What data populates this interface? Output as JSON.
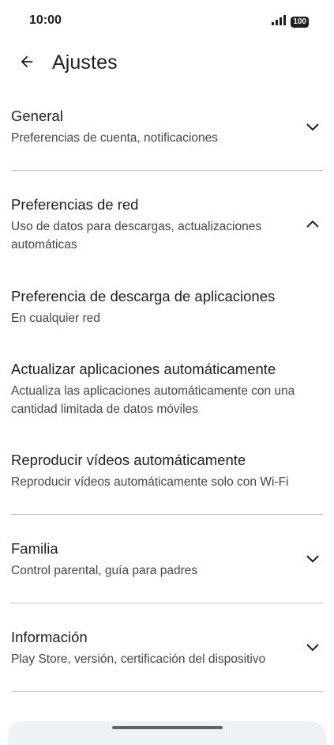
{
  "status_bar": {
    "time": "10:00",
    "battery": "100"
  },
  "header": {
    "title": "Ajustes"
  },
  "settings": [
    {
      "title": "General",
      "subtitle": "Preferencias de cuenta, notificaciones",
      "expanded": false
    },
    {
      "title": "Preferencias de red",
      "subtitle": "Uso de datos para descargas, actualizaciones automáticas",
      "expanded": true,
      "children": [
        {
          "title": "Preferencia de descarga de aplicaciones",
          "subtitle": "En cualquier red"
        },
        {
          "title": "Actualizar aplicaciones automáticamente",
          "subtitle": "Actualiza las aplicaciones automáticamente con una cantidad limitada de datos móviles"
        },
        {
          "title": "Reproducir vídeos automáticamente",
          "subtitle": "Reproducir vídeos automáticamente solo con Wi-Fi"
        }
      ]
    },
    {
      "title": "Familia",
      "subtitle": "Control parental, guía para padres",
      "expanded": false
    },
    {
      "title": "Información",
      "subtitle": "Play Store, versión, certificación del dispositivo",
      "expanded": false
    }
  ]
}
